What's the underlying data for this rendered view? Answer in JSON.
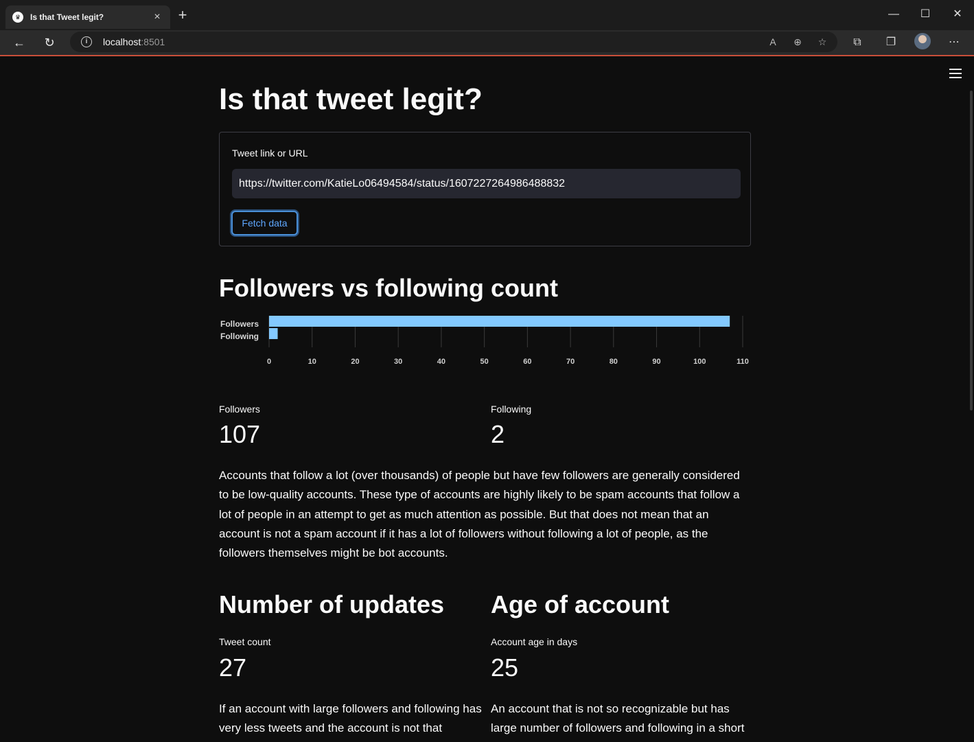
{
  "browser": {
    "tab_title": "Is that Tweet legit?",
    "url_host": "localhost",
    "url_port": ":8501",
    "tab_close": "×",
    "new_tab": "+"
  },
  "page": {
    "title": "Is that tweet legit?",
    "form": {
      "label": "Tweet link or URL",
      "value": "https://twitter.com/KatieLo06494584/status/1607227264986488832",
      "button": "Fetch data"
    },
    "followers_section": {
      "heading": "Followers vs following count",
      "followers_label": "Followers",
      "followers_value": "107",
      "following_label": "Following",
      "following_value": "2",
      "description": "Accounts that follow a lot (over thousands) of people but have few followers are generally considered to be low-quality accounts. These type of accounts are highly likely to be spam accounts that follow a lot of people in an attempt to get as much attention as possible. But that does not mean that an account is not a spam account if it has a lot of followers without following a lot of people, as the followers themselves might be bot accounts."
    },
    "updates_section": {
      "heading": "Number of updates",
      "label": "Tweet count",
      "value": "27",
      "description": "If an account with large followers and following has very less tweets and the account is not that"
    },
    "age_section": {
      "heading": "Age of account",
      "label": "Account age in days",
      "value": "25",
      "description": "An account that is not so recognizable but has large number of followers and following in a short period"
    }
  },
  "chart_data": {
    "type": "bar",
    "orientation": "horizontal",
    "categories": [
      "Followers",
      "Following"
    ],
    "values": [
      107,
      2
    ],
    "xlim": [
      0,
      110
    ],
    "xticks": [
      0,
      10,
      20,
      30,
      40,
      50,
      60,
      70,
      80,
      90,
      100,
      110
    ],
    "bar_color": "#83c9ff",
    "grid": true
  }
}
